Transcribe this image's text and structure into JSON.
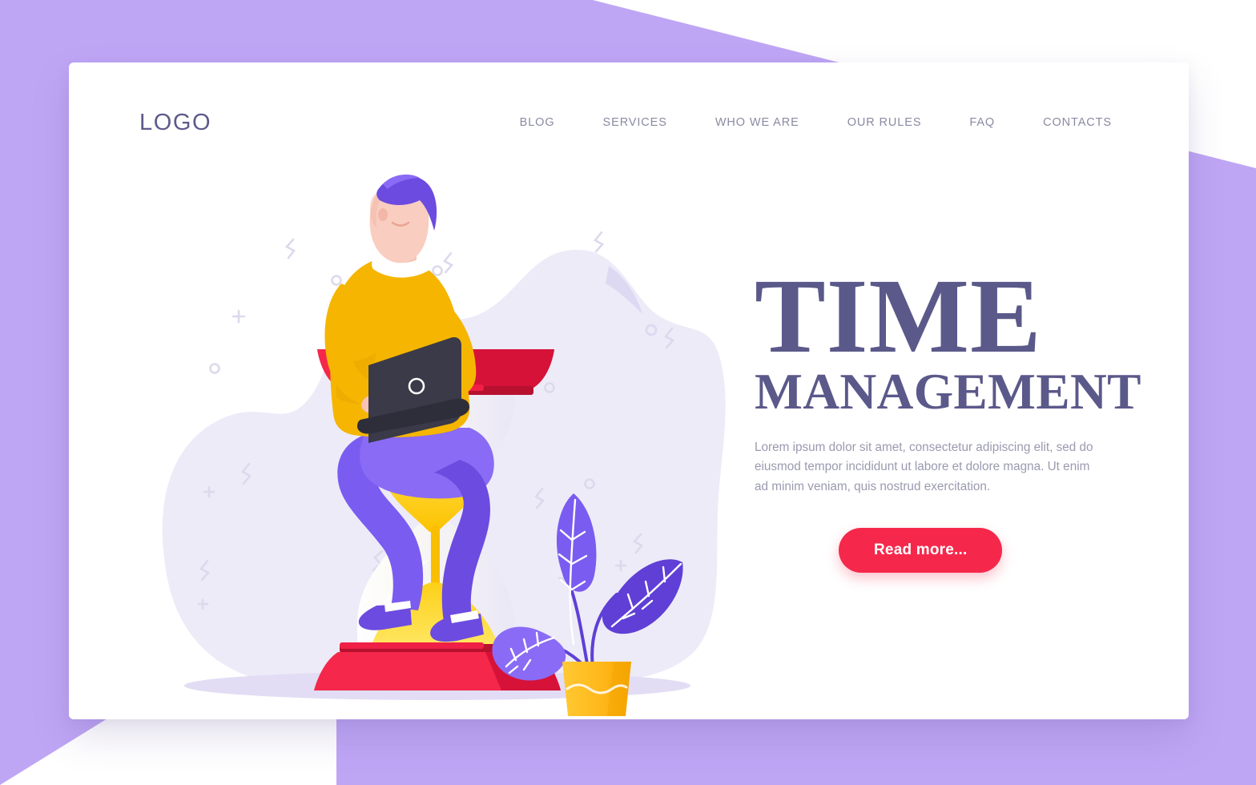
{
  "theme": {
    "page_background": "#BFA6F5",
    "card_background": "#FFFFFF",
    "heading_color": "#5B598A",
    "nav_color": "#8A8AA3",
    "body_text_color": "#9A9AB0",
    "accent_red": "#F5284B",
    "accent_yellow": "#FFC400",
    "accent_purple": "#6C4BE0",
    "blob_lavender": "#EDEBF8"
  },
  "header": {
    "logo": "LOGO",
    "nav": [
      {
        "label": "BLOG"
      },
      {
        "label": "SERVICES"
      },
      {
        "label": "WHO WE ARE"
      },
      {
        "label": "OUR RULES"
      },
      {
        "label": "FAQ"
      },
      {
        "label": "CONTACTS"
      }
    ]
  },
  "hero": {
    "title_main": "TIME",
    "title_sub": "MANAGEMENT",
    "paragraph": "Lorem ipsum dolor sit amet, consectetur adipiscing elit, sed do eiusmod tempor incididunt ut labore et dolore magna. Ut enim ad minim veniam, quis nostrud exercitation.",
    "cta_label": "Read more..."
  },
  "illustration": {
    "name": "person-sitting-on-hourglass-with-laptop",
    "elements": [
      "background-blob",
      "hourglass",
      "person-with-laptop",
      "potted-plant",
      "floor-shadow",
      "decorative-doodles"
    ]
  }
}
